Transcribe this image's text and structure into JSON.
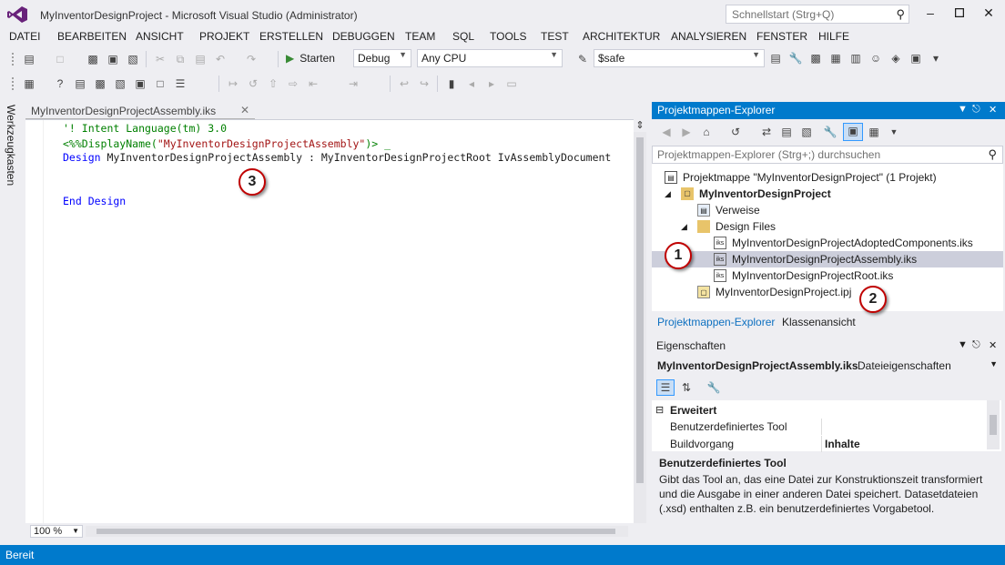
{
  "window": {
    "title": "MyInventorDesignProject - Microsoft Visual Studio (Administrator)",
    "quick_launch_placeholder": "Schnellstart (Strg+Q)",
    "buttons": {
      "minimize": "‒",
      "maximize": "▫",
      "close": "✕"
    }
  },
  "menu": {
    "items": [
      "DATEI",
      "BEARBEITEN",
      "ANSICHT",
      "PROJEKT",
      "ERSTELLEN",
      "DEBUGGEN",
      "TEAM",
      "SQL",
      "TOOLS",
      "TEST",
      "ARCHITEKTUR",
      "ANALYSIEREN",
      "FENSTER",
      "HILFE"
    ]
  },
  "toolbar": {
    "start_label": "Starten",
    "config": "Debug",
    "platform": "Any CPU",
    "find_value": "$safe"
  },
  "left_strip": {
    "label": "Werkzeugkasten"
  },
  "editor": {
    "tab_label": "MyInventorDesignProjectAssembly.iks",
    "lines": {
      "l1": "'! Intent Language(tm) 3.0",
      "l2_open": "<%%DisplayName(",
      "l2_str": "\"MyInventorDesignProjectAssembly\"",
      "l2_close": ")> _",
      "l3_kw": "Design",
      "l3_rest": " MyInventorDesignProjectAssembly : MyInventorDesignProjectRoot IvAssemblyDocument",
      "l5_kw": "End Design"
    },
    "zoom": "100 %"
  },
  "callouts": {
    "one": "1",
    "two": "2",
    "three": "3"
  },
  "solution_explorer": {
    "title": "Projektmappen-Explorer",
    "search_placeholder": "Projektmappen-Explorer (Strg+;) durchsuchen",
    "tree": {
      "solution": "Projektmappe \"MyInventorDesignProject\" (1 Projekt)",
      "project": "MyInventorDesignProject",
      "references": "Verweise",
      "design_files": "Design Files",
      "file1": "MyInventorDesignProjectAdoptedComponents.iks",
      "file2": "MyInventorDesignProjectAssembly.iks",
      "file3": "MyInventorDesignProjectRoot.iks",
      "ipj": "MyInventorDesignProject.ipj"
    },
    "tabs": {
      "explorer": "Projektmappen-Explorer",
      "classes": "Klassenansicht"
    }
  },
  "properties": {
    "title": "Eigenschaften",
    "object_name": "MyInventorDesignProjectAssembly.iks",
    "object_type": "Dateieigenschaften",
    "category": "Erweitert",
    "rows": [
      {
        "name": "Benutzerdefiniertes Tool",
        "value": ""
      },
      {
        "name": "Buildvorgang",
        "value": "Inhalte"
      }
    ],
    "desc_title": "Benutzerdefiniertes Tool",
    "desc_text": "Gibt das Tool an, das eine Datei zur Konstruktionszeit transformiert und die Ausgabe in einer anderen Datei speichert. Datasetdateien (.xsd) enthalten z.B. ein benutzerdefiniertes Vorgabetool."
  },
  "status": {
    "text": "Bereit"
  },
  "colors": {
    "accent": "#007acc",
    "callout_border": "#c00000",
    "keyword": "#0000ff",
    "comment": "#008000",
    "string": "#a31515"
  }
}
